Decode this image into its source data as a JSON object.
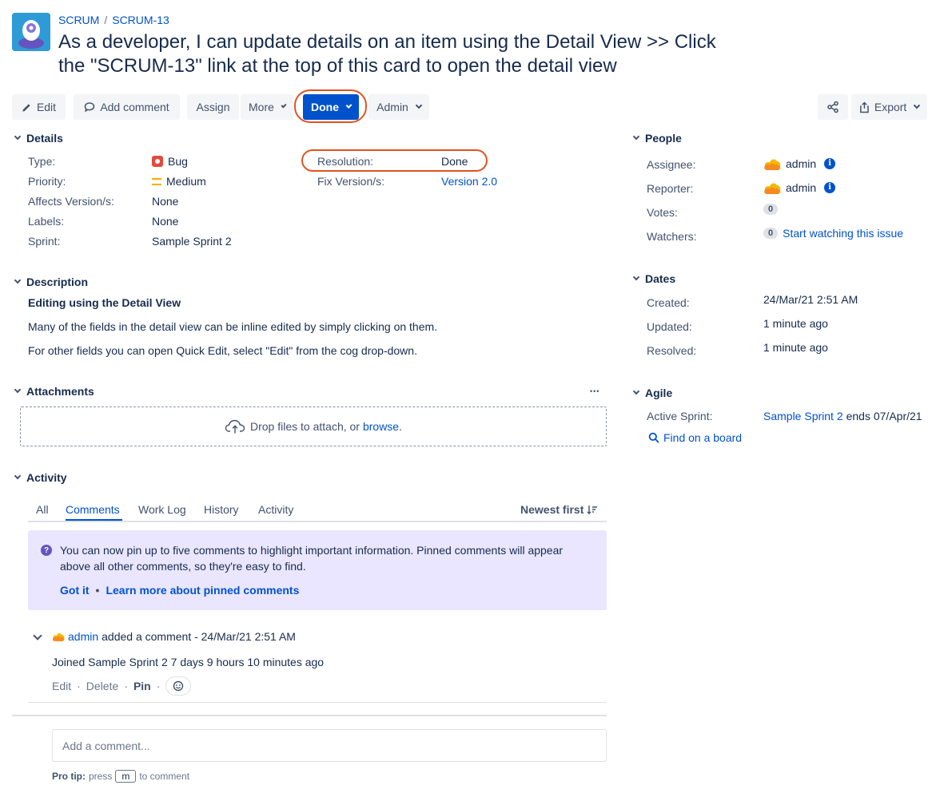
{
  "header": {
    "breadcrumb": [
      "SCRUM",
      "SCRUM-13"
    ],
    "breadcrumb_sep": "/",
    "title": "As a developer, I can update details on an item using the Detail View >> Click the \"SCRUM-13\" link at the top of this card to open the detail view"
  },
  "toolbar": {
    "edit": "Edit",
    "add_comment": "Add comment",
    "assign": "Assign",
    "more": "More",
    "done": "Done",
    "admin": "Admin",
    "export": "Export"
  },
  "details": {
    "heading": "Details",
    "type_label": "Type:",
    "type_value": "Bug",
    "priority_label": "Priority:",
    "priority_value": "Medium",
    "affects_label": "Affects Version/s:",
    "affects_value": "None",
    "labels_label": "Labels:",
    "labels_value": "None",
    "sprint_label": "Sprint:",
    "sprint_value": "Sample Sprint 2",
    "resolution_label": "Resolution:",
    "resolution_value": "Done",
    "fix_label": "Fix Version/s:",
    "fix_value": "Version 2.0"
  },
  "description": {
    "heading": "Description",
    "subheading": "Editing using the Detail View",
    "p1": "Many of the fields in the detail view can be inline edited by simply clicking on them.",
    "p2": "For other fields you can open Quick Edit, select \"Edit\" from the cog drop-down."
  },
  "attachments": {
    "heading": "Attachments",
    "more": "•••",
    "drop_text": "Drop files to attach, or",
    "browse": "browse",
    "period": "."
  },
  "activity": {
    "heading": "Activity",
    "tabs": [
      "All",
      "Comments",
      "Work Log",
      "History",
      "Activity"
    ],
    "sort": "Newest first",
    "info_text": "You can now pin up to five comments to highlight important information. Pinned comments will appear above all other comments, so they're easy to find.",
    "got_it": "Got it",
    "dot": "•",
    "learn_more": "Learn more about pinned comments",
    "comment_user": "admin",
    "comment_meta": "added a comment - 24/Mar/21 2:51 AM",
    "comment_body": "Joined Sample Sprint 2 7 days 9 hours 10 minutes ago",
    "actions": [
      "Edit",
      "Delete",
      "Pin"
    ],
    "action_sep": "·",
    "input_placeholder": "Add a comment...",
    "protip_label": "Pro tip:",
    "protip_press": "press",
    "protip_key": "m",
    "protip_end": "to comment"
  },
  "people": {
    "heading": "People",
    "assignee_label": "Assignee:",
    "assignee_value": "admin",
    "reporter_label": "Reporter:",
    "reporter_value": "admin",
    "votes_label": "Votes:",
    "votes_value": "0",
    "watchers_label": "Watchers:",
    "watchers_value": "0",
    "watch_link": "Start watching this issue"
  },
  "dates": {
    "heading": "Dates",
    "created_label": "Created:",
    "created_value": "24/Mar/21 2:51 AM",
    "updated_label": "Updated:",
    "updated_value": "1 minute ago",
    "resolved_label": "Resolved:",
    "resolved_value": "1 minute ago"
  },
  "agile": {
    "heading": "Agile",
    "active_label": "Active Sprint:",
    "active_value": "Sample Sprint 2",
    "active_suffix": "ends 07/Apr/21",
    "find_board": "Find on a board"
  },
  "colors": {
    "accent": "#0052cc",
    "highlight_oval": "#e0531f",
    "info_panel": "#eae6ff"
  },
  "icons": [
    "project-avatar-icon",
    "pencil-icon",
    "comment-icon",
    "chevron-down-icon",
    "share-icon",
    "export-icon",
    "bug-icon",
    "priority-medium-icon",
    "upload-cloud-icon",
    "help-icon",
    "user-avatar-icon",
    "info-icon",
    "search-icon",
    "emoji-icon",
    "sort-icon"
  ]
}
